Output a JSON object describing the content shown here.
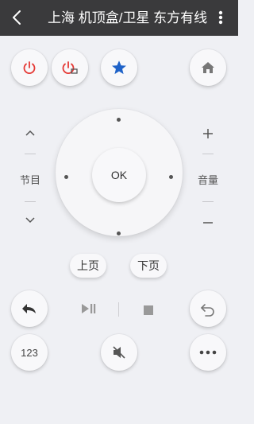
{
  "header": {
    "title": "上海 机顶盒/卫星 东方有线"
  },
  "channel": {
    "label": "节目",
    "up": "^",
    "down": "v"
  },
  "volume": {
    "label": "音量",
    "up": "+",
    "down": "−"
  },
  "dpad": {
    "ok_label": "OK"
  },
  "paging": {
    "prev_label": "上页",
    "next_label": "下页"
  },
  "keypad": {
    "label": "123"
  },
  "colors": {
    "power_red": "#e53935",
    "star_blue": "#1e62c8",
    "topbar": "#3a3a3c"
  }
}
